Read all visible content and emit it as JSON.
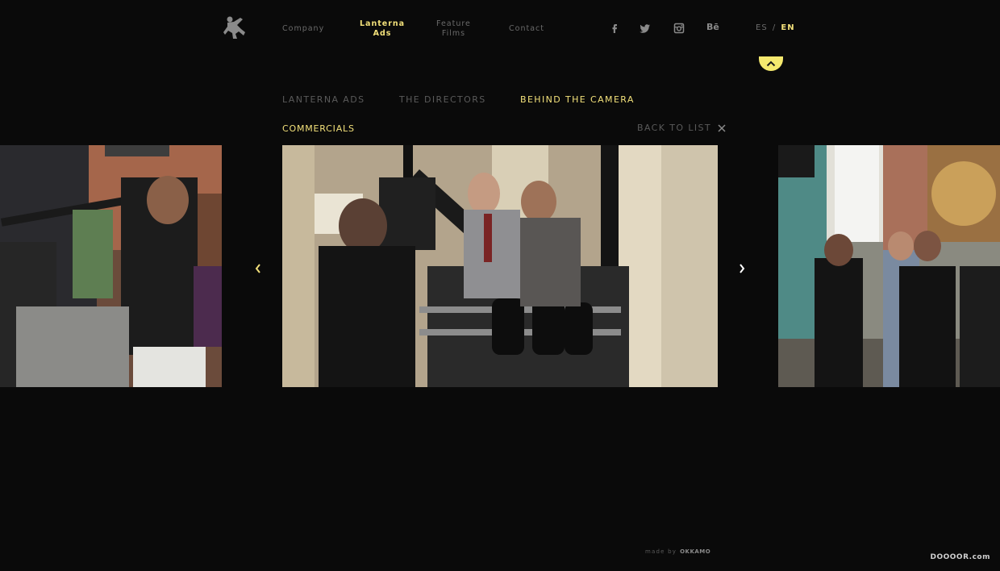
{
  "header": {
    "nav": [
      {
        "label_line1": "Company",
        "label_line2": "",
        "active": false
      },
      {
        "label_line1": "Lanterna",
        "label_line2": "Ads",
        "active": true
      },
      {
        "label_line1": "Feature",
        "label_line2": "Films",
        "active": false
      },
      {
        "label_line1": "Contact",
        "label_line2": "",
        "active": false
      }
    ],
    "social_icons": [
      "facebook-icon",
      "twitter-icon",
      "instagram-icon",
      "behance-icon"
    ],
    "behance_text": "Bē",
    "lang": {
      "es": "ES",
      "sep": "/",
      "en": "EN",
      "active": "EN"
    }
  },
  "subnav": {
    "tabs": [
      {
        "label": "LANTERNA ADS",
        "active": false
      },
      {
        "label": "THE DIRECTORS",
        "active": false
      },
      {
        "label": "BEHIND THE CAMERA",
        "active": true
      }
    ]
  },
  "section": {
    "title": "COMMERCIALS",
    "back_label": "BACK TO LIST"
  },
  "gallery": {
    "prev_icon": "chevron-left-icon",
    "next_icon": "chevron-right-icon"
  },
  "footer": {
    "made_by": "made by",
    "brand": "OKKAMO",
    "watermark": "DOOOOR.com"
  },
  "colors": {
    "background": "#0a0a0a",
    "accent": "#f2e07a",
    "muted": "#5a5a5a"
  }
}
